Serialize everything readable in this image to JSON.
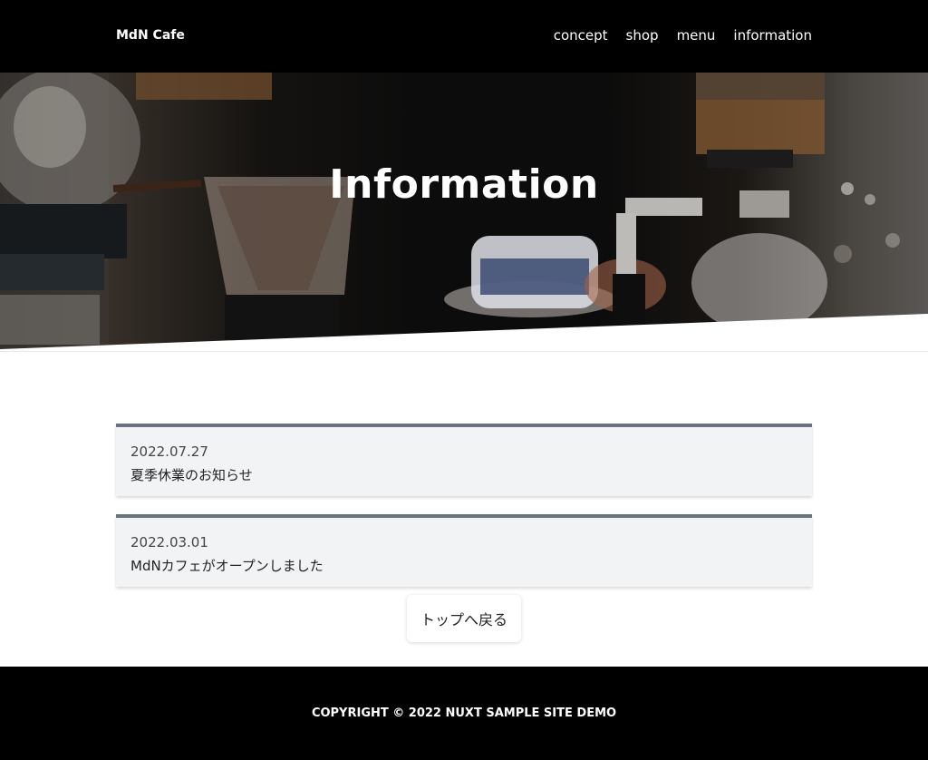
{
  "header": {
    "brand": "MdN Cafe",
    "nav": [
      {
        "label": "concept"
      },
      {
        "label": "shop"
      },
      {
        "label": "menu"
      },
      {
        "label": "information"
      }
    ]
  },
  "hero": {
    "title": "Information"
  },
  "news": [
    {
      "date": "2022.07.27",
      "title": "夏季休業のお知らせ"
    },
    {
      "date": "2022.03.01",
      "title": "MdNカフェがオープンしました"
    }
  ],
  "back_button": {
    "label": "トップへ戻る"
  },
  "footer": {
    "copyright": "COPYRIGHT © 2022 NUXT SAMPLE SITE DEMO"
  },
  "colors": {
    "header_bg": "#000000",
    "card_bg": "#f2f3f5",
    "card_border": "#6b7280",
    "footer_bg": "#000000"
  }
}
